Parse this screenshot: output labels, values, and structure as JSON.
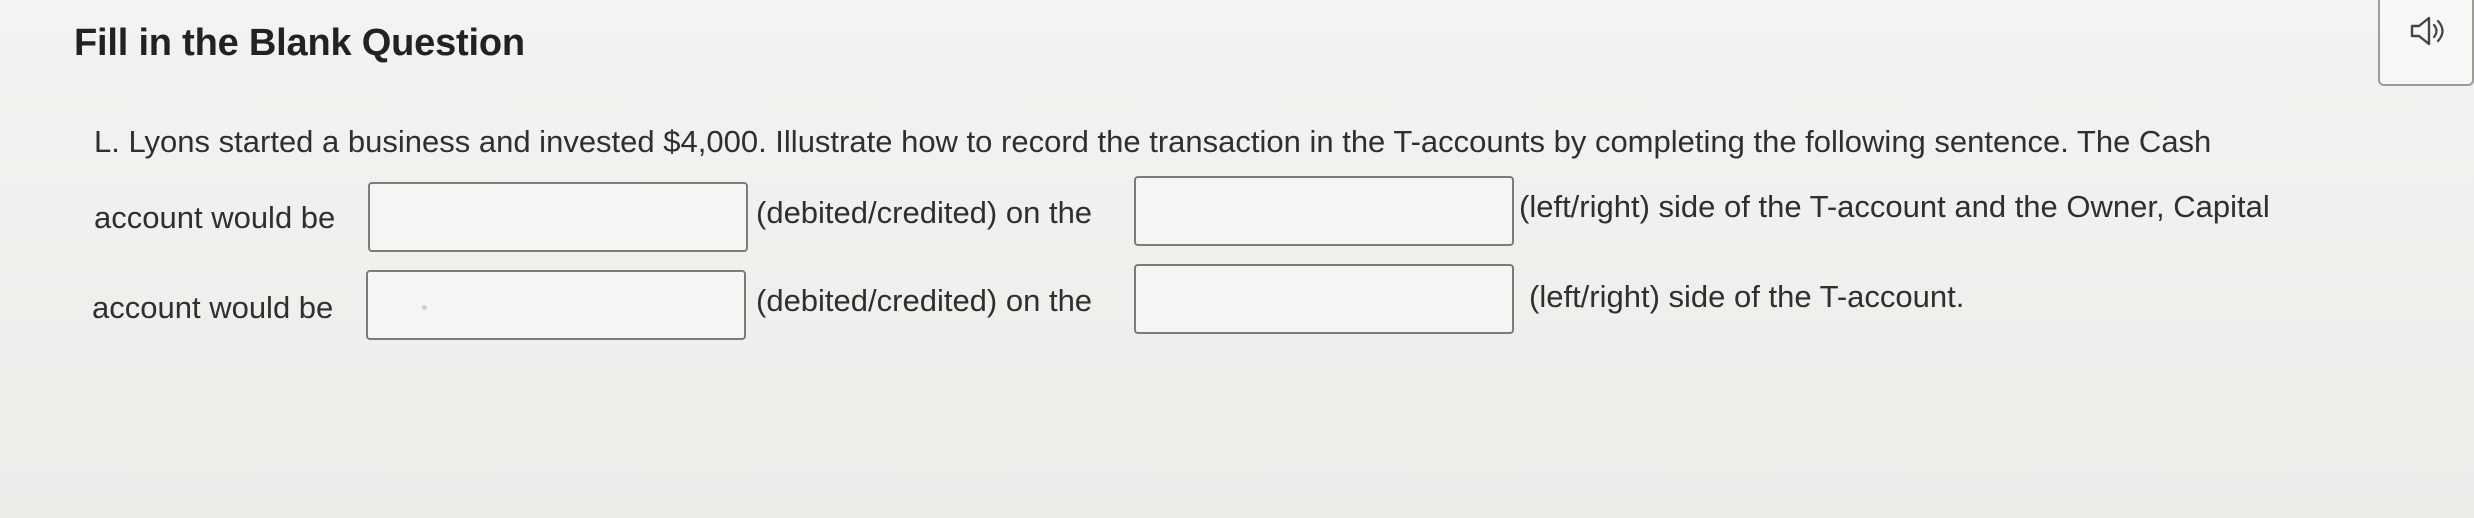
{
  "question": {
    "title": "Fill in the Blank Question",
    "intro": "L. Lyons started a business and invested $4,000. Illustrate how to record the transaction in the T-accounts by completing the following sentence. The Cash",
    "row1_prefix": "account would be",
    "row1_mid": "(debited/credited) on the",
    "row1_suffix": "(left/right) side of the T-account and the Owner, Capital",
    "row2_prefix": "account would be",
    "row2_mid": "(debited/credited) on the",
    "row2_suffix": "(left/right) side of the T-account.",
    "blanks": [
      "",
      "",
      "",
      ""
    ]
  },
  "audio_button": {
    "icon": "speaker-icon"
  }
}
